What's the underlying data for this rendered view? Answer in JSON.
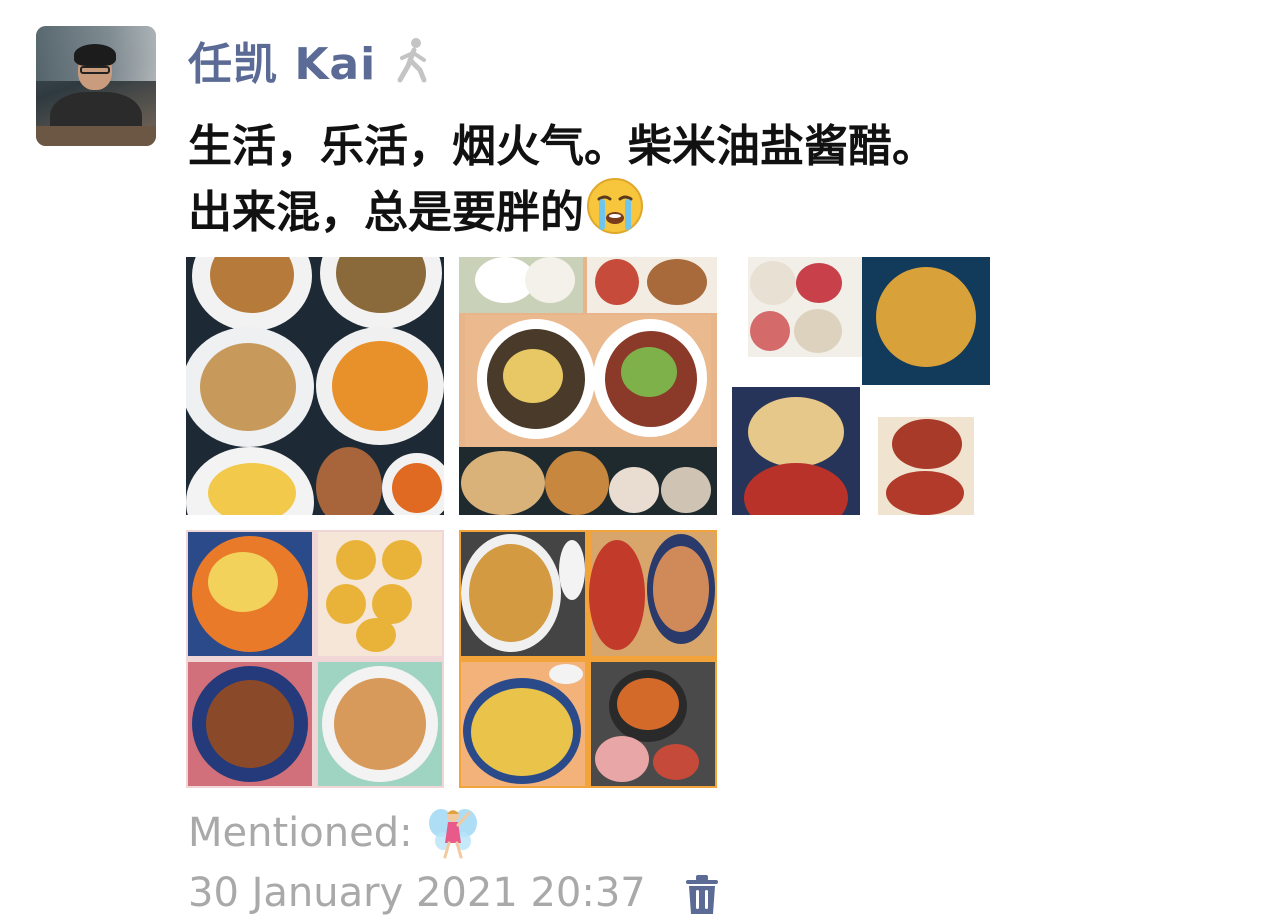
{
  "post": {
    "author": "任凯 Kai",
    "line1": "生活，乐活，烟火气。柴米油盐酱醋。",
    "line2": "出来混，总是要胖的",
    "mentioned_label": "Mentioned:",
    "timestamp": "30 January 2021 20:37"
  },
  "icons": {
    "author_status": "walking-person-icon",
    "line2_emoji": "crying-face-emoji",
    "mention_emoji": "fairy-emoji",
    "delete": "trash-icon"
  },
  "colors": {
    "author_name": "#5b6b95",
    "secondary_text": "#a9a9a9",
    "body_text": "#111111"
  },
  "photos_count": 5
}
